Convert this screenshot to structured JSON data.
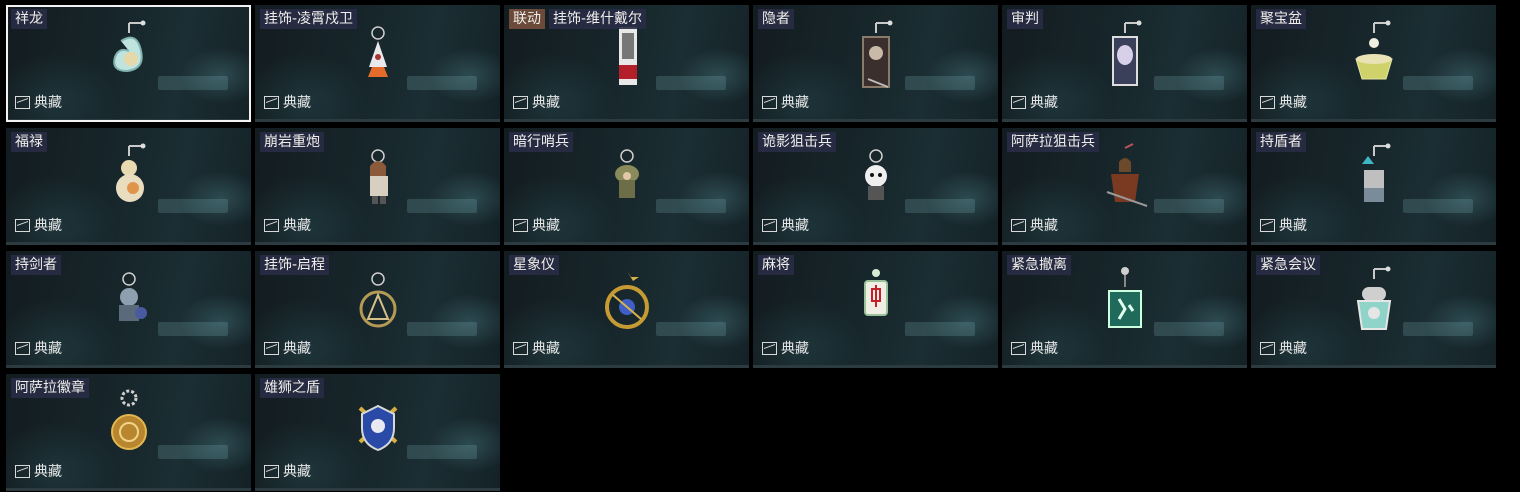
{
  "rarity_label": "典藏",
  "items": [
    {
      "name": "祥龙",
      "icon": "dragon-charm-icon",
      "selected": true
    },
    {
      "name": "挂饰-凌霄戍卫",
      "icon": "rocket-charm-icon"
    },
    {
      "tag": "联动",
      "name": "挂饰-维什戴尔",
      "icon": "card-charm-icon"
    },
    {
      "name": "隐者",
      "icon": "hermit-card-charm-icon"
    },
    {
      "name": "审判",
      "icon": "judgment-card-charm-icon"
    },
    {
      "name": "聚宝盆",
      "icon": "treasure-bowl-charm-icon"
    },
    {
      "name": "福禄",
      "icon": "gourd-charm-icon"
    },
    {
      "name": "崩岩重炮",
      "icon": "cannon-figure-charm-icon"
    },
    {
      "name": "暗行哨兵",
      "icon": "sentry-figure-charm-icon"
    },
    {
      "name": "诡影狙击兵",
      "icon": "sniper-figure-charm-icon"
    },
    {
      "name": "阿萨拉狙击兵",
      "icon": "asala-sniper-charm-icon"
    },
    {
      "name": "持盾者",
      "icon": "shield-bearer-charm-icon"
    },
    {
      "name": "持剑者",
      "icon": "swordsman-charm-icon"
    },
    {
      "name": "挂饰-启程",
      "icon": "compass-ring-charm-icon"
    },
    {
      "name": "星象仪",
      "icon": "astrolabe-charm-icon"
    },
    {
      "name": "麻将",
      "icon": "mahjong-tile-charm-icon"
    },
    {
      "name": "紧急撤离",
      "icon": "exit-sign-charm-icon"
    },
    {
      "name": "紧急会议",
      "icon": "meeting-charm-icon"
    },
    {
      "name": "阿萨拉徽章",
      "icon": "asala-badge-charm-icon"
    },
    {
      "name": "雄狮之盾",
      "icon": "lion-shield-charm-icon"
    }
  ]
}
